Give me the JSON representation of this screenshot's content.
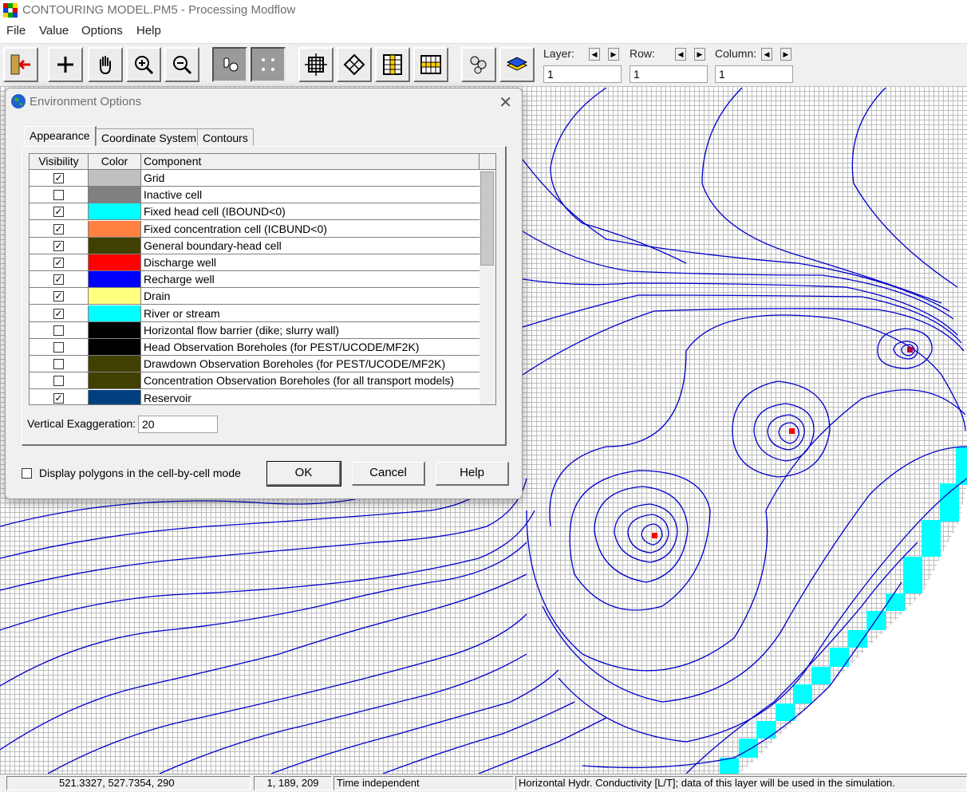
{
  "window": {
    "title": "CONTOURING MODEL.PM5 - Processing Modflow"
  },
  "menu": [
    "File",
    "Value",
    "Options",
    "Help"
  ],
  "toolbar": {
    "buttons": [
      "exit-icon",
      "add-icon",
      "pan-hand-icon",
      "zoom-in-icon",
      "zoom-out-icon",
      "view-cells-icon",
      "view-dots-icon",
      "move-grid-icon",
      "rotate-grid-icon",
      "column-icon",
      "row-icon",
      "run-icon",
      "layer-color-icon"
    ],
    "layer_label": "Layer:",
    "row_label": "Row:",
    "column_label": "Column:",
    "layer_value": "1",
    "row_value": "1",
    "column_value": "1"
  },
  "dialog": {
    "title": "Environment Options",
    "tabs": [
      "Appearance",
      "Coordinate System",
      "Contours"
    ],
    "columns": [
      "Visibility",
      "Color",
      "Component"
    ],
    "rows": [
      {
        "visible": true,
        "color": "#c0c0c0",
        "component": "Grid"
      },
      {
        "visible": false,
        "color": "#808080",
        "component": "Inactive cell"
      },
      {
        "visible": true,
        "color": "#00ffff",
        "component": "Fixed head cell (IBOUND<0)"
      },
      {
        "visible": true,
        "color": "#ff8040",
        "component": "Fixed concentration cell (ICBUND<0)"
      },
      {
        "visible": true,
        "color": "#404000",
        "component": "General boundary-head cell"
      },
      {
        "visible": true,
        "color": "#ff0000",
        "component": "Discharge well"
      },
      {
        "visible": true,
        "color": "#0000ff",
        "component": "Recharge well"
      },
      {
        "visible": true,
        "color": "#ffff80",
        "component": "Drain"
      },
      {
        "visible": true,
        "color": "#00ffff",
        "component": "River or stream"
      },
      {
        "visible": false,
        "color": "#000000",
        "component": "Horizontal flow barrier (dike; slurry wall)"
      },
      {
        "visible": false,
        "color": "#000000",
        "component": "Head Observation Boreholes (for PEST/UCODE/MF2K)"
      },
      {
        "visible": false,
        "color": "#404000",
        "component": "Drawdown Observation Boreholes (for PEST/UCODE/MF2K)"
      },
      {
        "visible": false,
        "color": "#404000",
        "component": "Concentration Observation Boreholes (for all transport models)"
      },
      {
        "visible": true,
        "color": "#004080",
        "component": "Reservoir"
      }
    ],
    "vertical_exaggeration_label": "Vertical Exaggeration:",
    "vertical_exaggeration_value": "20",
    "display_polygons_label": "Display polygons in the cell-by-cell mode",
    "display_polygons_checked": false,
    "ok_label": "OK",
    "cancel_label": "Cancel",
    "help_label": "Help"
  },
  "status": {
    "coords": "521.3327,  527.7354,        290",
    "cell": "1, 189, 209",
    "time": "Time independent",
    "message": "Horizontal Hydr. Conductivity [L/T]; data of this layer will be used in the simulation."
  },
  "colors": {
    "contour": "#0000cc",
    "fixed_head": "#00ffff",
    "well": "#ff0000"
  }
}
